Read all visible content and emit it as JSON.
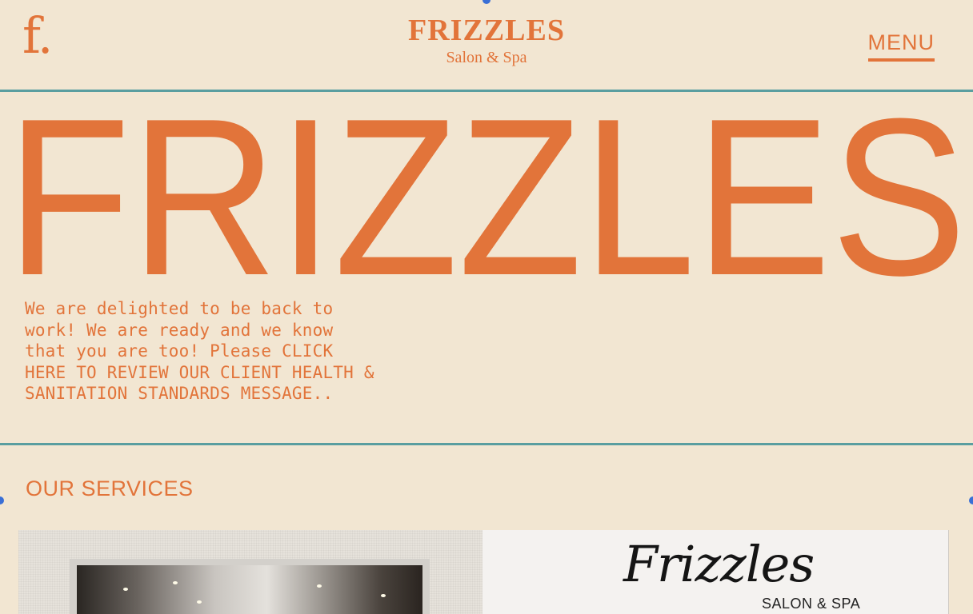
{
  "header": {
    "logo_mark": "f.",
    "brand_name": "FRIZZLES",
    "brand_tagline": "Salon & Spa",
    "menu_label": "MENU"
  },
  "hero": {
    "headline": "FRIZZLES",
    "intro_text": "We are delighted to be back to work! We are ready and we know that you are too! Please CLICK HERE TO REVIEW OUR CLIENT HEALTH & SANITATION STANDARDS MESSAGE.."
  },
  "services": {
    "title": "OUR SERVICES",
    "cards": [
      {
        "image": "salon-interior-photo"
      },
      {
        "logo_text": "Frizzles",
        "logo_sub": "SALON & SPA"
      }
    ]
  },
  "colors": {
    "background": "#f2e6d2",
    "accent": "#e2743a",
    "divider": "#5a9ea0",
    "selection_handle": "#3a6fd6"
  }
}
